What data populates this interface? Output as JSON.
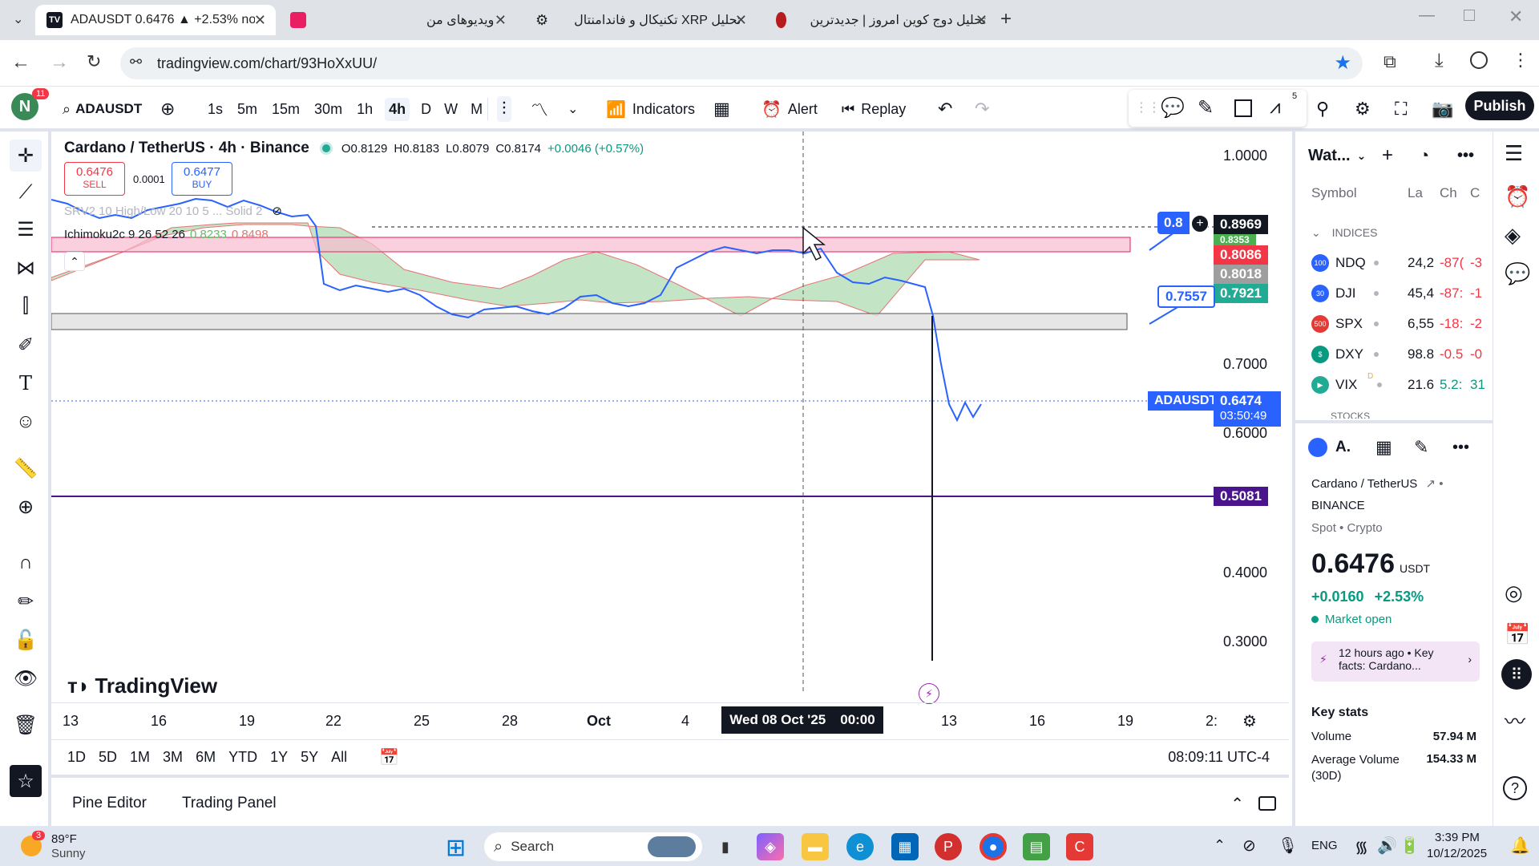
{
  "browser": {
    "tabs": [
      {
        "title": "ADAUSDT 0.6476 ▲ +2.53% no",
        "active": true
      },
      {
        "title": "ویدیوهای من"
      },
      {
        "title": "تحلیل XRP تکنیکال و فاندامنتال"
      },
      {
        "title": "تحلیل دوج کوین امروز | جدیدترین"
      }
    ],
    "url": "tradingview.com/chart/93HoXxUU/"
  },
  "header": {
    "avatar_letter": "N",
    "notif_count": "11",
    "symbol": "ADAUSDT",
    "intervals": [
      "1s",
      "5m",
      "15m",
      "30m",
      "1h",
      "4h",
      "D",
      "W",
      "M"
    ],
    "active_interval": "4h",
    "indicators": "Indicators",
    "alert": "Alert",
    "replay": "Replay",
    "publish": "Publish",
    "counter": "5"
  },
  "chart": {
    "title": "Cardano / TetherUS · 4h · Binance",
    "ohlc": {
      "o": "O0.8129",
      "h": "H0.8183",
      "l": "L0.8079",
      "c": "C0.8174",
      "chg": "+0.0046 (+0.57%)"
    },
    "sell": {
      "price": "0.6476",
      "label": "SELL"
    },
    "spread": "0.0001",
    "buy": {
      "price": "0.6477",
      "label": "BUY"
    },
    "ind1": "SRV2 10 High/Low 20 10 5 ... Solid 2",
    "ind2": {
      "name": "Ichimoku2c 9 26 52 26",
      "v1": "0.8233",
      "v2": "0.8498"
    },
    "price_axis": [
      "1.0000",
      "0.7000",
      "0.6000",
      "0.4000",
      "0.3000"
    ],
    "tags": {
      "top_blue": "0.8",
      "p1": "0.8969",
      "p2": "0.8353",
      "p3": "0.8086",
      "p4": "0.8018",
      "p5": "0.7921",
      "left_blue": "0.7557",
      "sym_label": "ADAUSDT",
      "current": "0.6474",
      "countdown": "03:50:49",
      "purple": "0.5081"
    },
    "time_axis": [
      "13",
      "16",
      "19",
      "22",
      "25",
      "28",
      "Oct",
      "4",
      "13",
      "16",
      "19",
      "2:"
    ],
    "crosshair_time": "Wed 08 Oct '25",
    "crosshair_hour": "00:00",
    "logo_text": "TradingView",
    "ranges": [
      "1D",
      "5D",
      "1M",
      "3M",
      "6M",
      "YTD",
      "1Y",
      "5Y",
      "All"
    ],
    "clock": "08:09:11 UTC-4"
  },
  "bottom": {
    "pine": "Pine Editor",
    "trading": "Trading Panel"
  },
  "watchlist": {
    "title": "Wat...",
    "col_symbol": "Symbol",
    "col_last": "La",
    "col_chg": "Ch",
    "col_chgp": "C",
    "section": "INDICES",
    "rows": [
      {
        "badge": "100",
        "color": "#2962ff",
        "sym": "NDQ",
        "last": "24,2",
        "chg": "-87(",
        "chgp": "-3"
      },
      {
        "badge": "30",
        "color": "#2962ff",
        "sym": "DJI",
        "last": "45,4",
        "chg": "-87:",
        "chgp": "-1"
      },
      {
        "badge": "500",
        "color": "#e53935",
        "sym": "SPX",
        "last": "6,55",
        "chg": "-18:",
        "chgp": "-2"
      },
      {
        "badge": "$",
        "color": "#089981",
        "sym": "DXY",
        "last": "98.8",
        "chg": "-0.5",
        "chgp": "-0"
      },
      {
        "badge": "▶",
        "color": "#22ab94",
        "sym": "VIX",
        "last": "21.6",
        "chg": "5.2:",
        "chgp": "31",
        "sup": "D"
      }
    ],
    "section2": "STOCKS"
  },
  "details": {
    "short": "A.",
    "name": "Cardano / TetherUS",
    "exchange": "BINANCE",
    "type": "Spot • Crypto",
    "price": "0.6476",
    "currency": "USDT",
    "change": "+0.0160",
    "change_pct": "+2.53%",
    "status": "Market open",
    "news_time": "12 hours ago",
    "news_text": "Key facts: Cardano...",
    "key_stats": "Key stats",
    "volume_label": "Volume",
    "volume": "57.94 M",
    "avg_label": "Average Volume (30D)",
    "avg": "154.33 M"
  },
  "taskbar": {
    "temp": "89°F",
    "weather": "Sunny",
    "weather_badge": "3",
    "search": "Search",
    "lang": "ENG",
    "time": "3:39 PM",
    "date": "10/12/2025"
  }
}
